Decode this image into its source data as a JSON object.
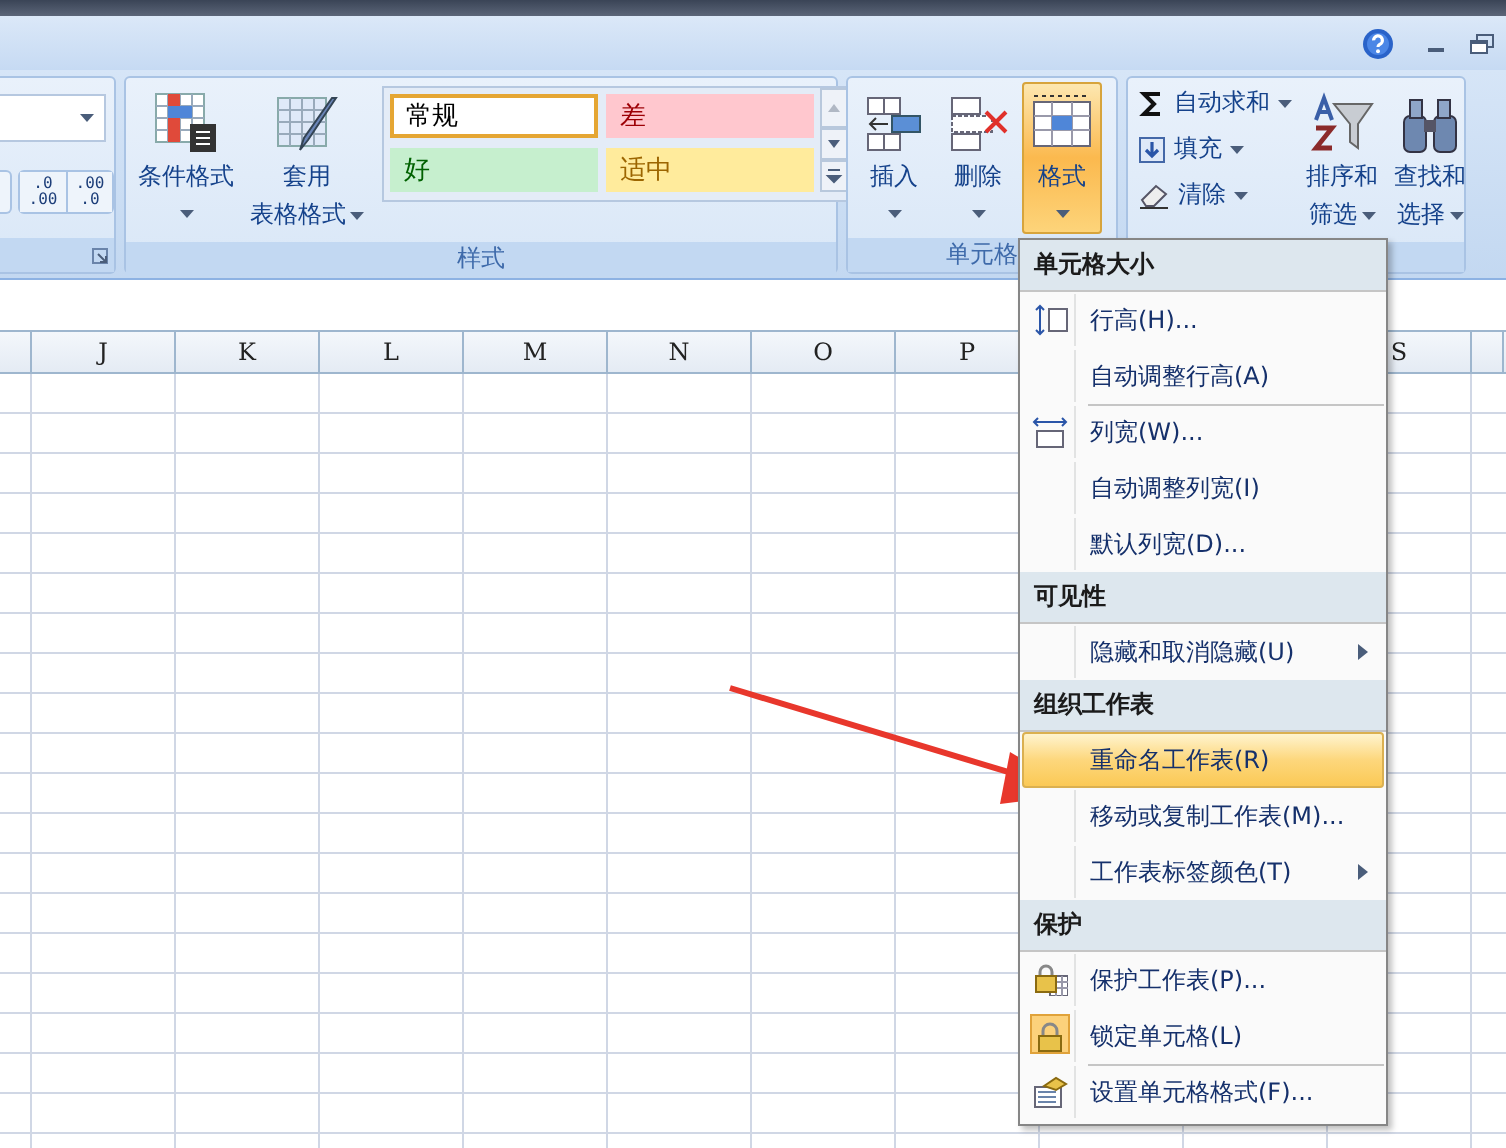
{
  "number_group": {
    "launcher": true,
    "decimal_buttons": [
      {
        "upper": ".0",
        "lower": ".00"
      },
      {
        "upper": ".00",
        "lower": ".0"
      }
    ]
  },
  "styles_group": {
    "label": "样式",
    "buttons": [
      {
        "kind": "conditional",
        "lines": [
          "条件格式"
        ],
        "dropdown_below": true
      },
      {
        "kind": "table",
        "lines": [
          "套用",
          "表格格式"
        ],
        "dropdown_below": false
      }
    ],
    "gallery": [
      {
        "label": "常规",
        "color": "#ffffff",
        "selected": true
      },
      {
        "label": "差",
        "color": "#ffc7ce",
        "selected": false
      },
      {
        "label": "好",
        "color": "#c6efce",
        "selected": false
      },
      {
        "label": "适中",
        "color": "#ffeb9c",
        "selected": false
      }
    ]
  },
  "cells_group": {
    "label": "单元格",
    "buttons": [
      {
        "kind": "insert",
        "label": "插入",
        "selected": false
      },
      {
        "kind": "delete",
        "label": "删除",
        "selected": false
      },
      {
        "kind": "format",
        "label": "格式",
        "selected": true
      }
    ]
  },
  "editing_group": {
    "small_buttons": [
      {
        "kind": "sum",
        "label": "自动求和"
      },
      {
        "kind": "fill",
        "label": "填充"
      },
      {
        "kind": "clear",
        "label": "清除"
      }
    ],
    "big_buttons": [
      {
        "kind": "sort",
        "lines": [
          "排序和",
          "筛选"
        ]
      },
      {
        "kind": "find",
        "lines": [
          "查找和",
          "选择"
        ]
      }
    ]
  },
  "sheet": {
    "columns": [
      "J",
      "K",
      "L",
      "M",
      "N",
      "O",
      "P"
    ],
    "columns_right": [
      "S"
    ]
  },
  "menu": {
    "sections": [
      {
        "title": "单元格大小",
        "items": [
          {
            "label": "行高(H)...",
            "selected": false,
            "checked": false,
            "submenu": false,
            "separator_before": false
          },
          {
            "label": "自动调整行高(A)",
            "selected": false,
            "checked": false,
            "submenu": false,
            "separator_before": false
          },
          {
            "label": "列宽(W)...",
            "selected": false,
            "checked": false,
            "submenu": false,
            "separator_before": true
          },
          {
            "label": "自动调整列宽(I)",
            "selected": false,
            "checked": false,
            "submenu": false,
            "separator_before": false
          },
          {
            "label": "默认列宽(D)...",
            "selected": false,
            "checked": false,
            "submenu": false,
            "separator_before": false
          }
        ]
      },
      {
        "title": "可见性",
        "items": [
          {
            "label": "隐藏和取消隐藏(U)",
            "selected": false,
            "checked": false,
            "submenu": true,
            "separator_before": false
          }
        ]
      },
      {
        "title": "组织工作表",
        "items": [
          {
            "label": "重命名工作表(R)",
            "selected": true,
            "checked": false,
            "submenu": false,
            "separator_before": false
          },
          {
            "label": "移动或复制工作表(M)...",
            "selected": false,
            "checked": false,
            "submenu": false,
            "separator_before": false
          },
          {
            "label": "工作表标签颜色(T)",
            "selected": false,
            "checked": false,
            "submenu": true,
            "separator_before": false
          }
        ]
      },
      {
        "title": "保护",
        "items": [
          {
            "label": "保护工作表(P)...",
            "selected": false,
            "checked": false,
            "submenu": false,
            "separator_before": false
          },
          {
            "label": "锁定单元格(L)",
            "selected": false,
            "checked": true,
            "submenu": false,
            "separator_before": false
          },
          {
            "label": "设置单元格格式(F)...",
            "selected": false,
            "checked": false,
            "submenu": false,
            "separator_before": true
          }
        ]
      }
    ]
  }
}
